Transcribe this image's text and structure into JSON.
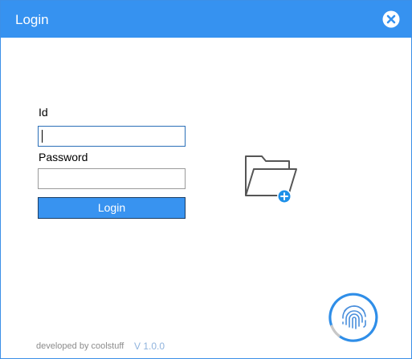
{
  "window": {
    "title": "Login",
    "close_icon": "close-circle-icon",
    "accent_color": "#3692f0"
  },
  "form": {
    "id_label": "Id",
    "id_value": "",
    "password_label": "Password",
    "password_value": "",
    "login_button_label": "Login"
  },
  "icons": {
    "folder": "folder-add-icon",
    "fingerprint": "fingerprint-icon"
  },
  "footer": {
    "developer_text": "developed by coolstuff",
    "version_text": "V 1.0.0"
  }
}
